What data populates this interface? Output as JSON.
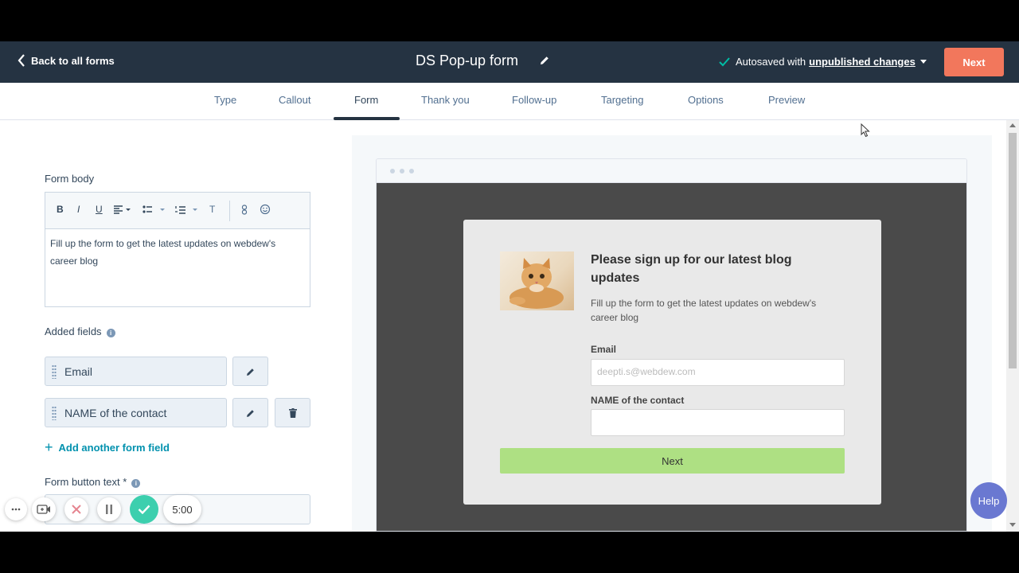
{
  "header": {
    "back_label": "Back to all forms",
    "form_title": "DS Pop-up form",
    "autosave_prefix": "Autosaved with",
    "autosave_link": "unpublished changes",
    "next_label": "Next"
  },
  "tabs": [
    {
      "label": "Type"
    },
    {
      "label": "Callout"
    },
    {
      "label": "Form",
      "active": true
    },
    {
      "label": "Thank you"
    },
    {
      "label": "Follow-up"
    },
    {
      "label": "Targeting"
    },
    {
      "label": "Options"
    },
    {
      "label": "Preview"
    }
  ],
  "left_panel": {
    "form_body_label": "Form body",
    "toolbar": {
      "bold": "B",
      "italic": "I",
      "underline": "U",
      "clear_format": "T"
    },
    "form_body_text": "Fill up the form to get the latest updates on webdew's career blog",
    "added_fields_label": "Added fields",
    "fields": [
      {
        "label": "Email"
      },
      {
        "label": "NAME of the contact"
      }
    ],
    "add_field_label": "Add another form field",
    "form_button_text_label": "Form button text *"
  },
  "recorder": {
    "timer": "5:00"
  },
  "preview": {
    "heading": "Please sign up for our latest blog updates",
    "subtext": "Fill up the form to get the latest updates on webdew's career blog",
    "email_label": "Email",
    "email_placeholder": "deepti.s@webdew.com",
    "name_label": "NAME of the contact",
    "next_label": "Next"
  },
  "help_label": "Help",
  "colors": {
    "header_bg": "#253342",
    "next_button": "#f2775c",
    "popup_button": "#aee083",
    "link": "#0091ae",
    "help": "#6a78d1"
  }
}
